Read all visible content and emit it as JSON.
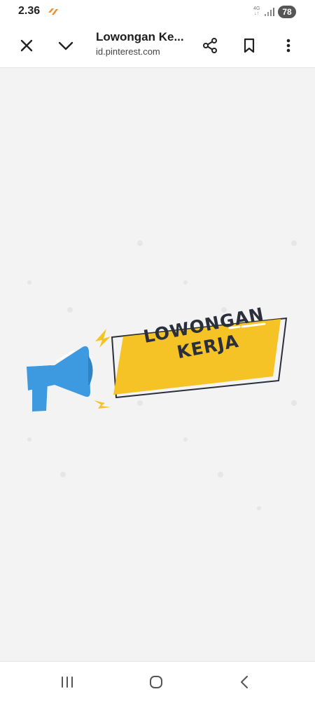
{
  "status_bar": {
    "time": "2.36",
    "network_type": "4G",
    "battery_level": "78",
    "notification_icon": "brand-notification-icon",
    "signal_icon": "signal-bars-icon"
  },
  "toolbar": {
    "title": "Lowongan Ke...",
    "url": "id.pinterest.com",
    "close_icon": "close-icon",
    "collapse_icon": "chevron-down-icon",
    "share_icon": "share-icon",
    "bookmark_icon": "bookmark-icon",
    "more_icon": "more-vertical-icon"
  },
  "content": {
    "banner_line1": "LOWONGAN",
    "banner_line2": "KERJA",
    "megaphone_icon": "megaphone-icon",
    "colors": {
      "background": "#f3f3f4",
      "banner_fill": "#f5c325",
      "banner_outline": "#2b2f3a",
      "megaphone": "#3d9ae0",
      "spark": "#f5c325"
    }
  },
  "nav_bar": {
    "recents_icon": "recents-icon",
    "home_icon": "home-icon",
    "back_icon": "back-icon"
  }
}
